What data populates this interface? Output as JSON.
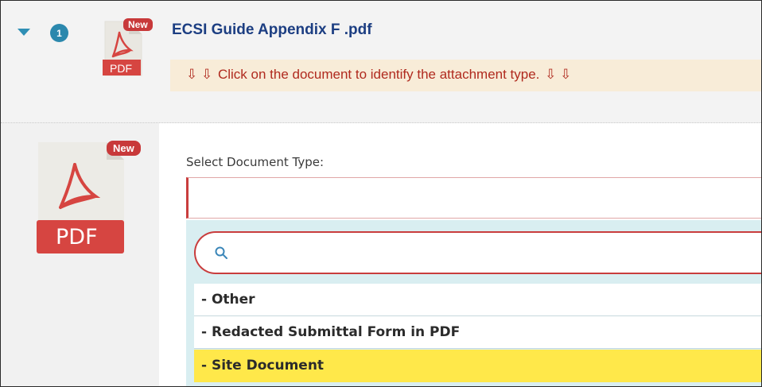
{
  "header": {
    "group_count": "1",
    "new_tag": "New",
    "pdf_label": "PDF",
    "document_title": "ECSI Guide Appendix F .pdf",
    "hint_arrows_left": "⇩ ⇩",
    "hint_text": "Click on the document to identify the attachment type.",
    "hint_arrows_right": "⇩ ⇩"
  },
  "preview": {
    "new_tag": "New",
    "pdf_label": "PDF"
  },
  "form": {
    "field_label": "Select Document Type:",
    "selected_value": "",
    "search_placeholder": "",
    "options": [
      {
        "label": "- Other"
      },
      {
        "label": "- Redacted Submittal Form in PDF"
      },
      {
        "label": "- Site Document"
      }
    ],
    "highlighted_option": "- Site Document"
  },
  "colors": {
    "accent_blue": "#2b88ad",
    "title_blue": "#1c3e82",
    "hint_red": "#b02a1e",
    "hint_bg": "#f8ecd8",
    "pdf_red": "#d64541",
    "highlight_yellow": "#ffe84a",
    "dropdown_bg": "#d9eef1"
  }
}
